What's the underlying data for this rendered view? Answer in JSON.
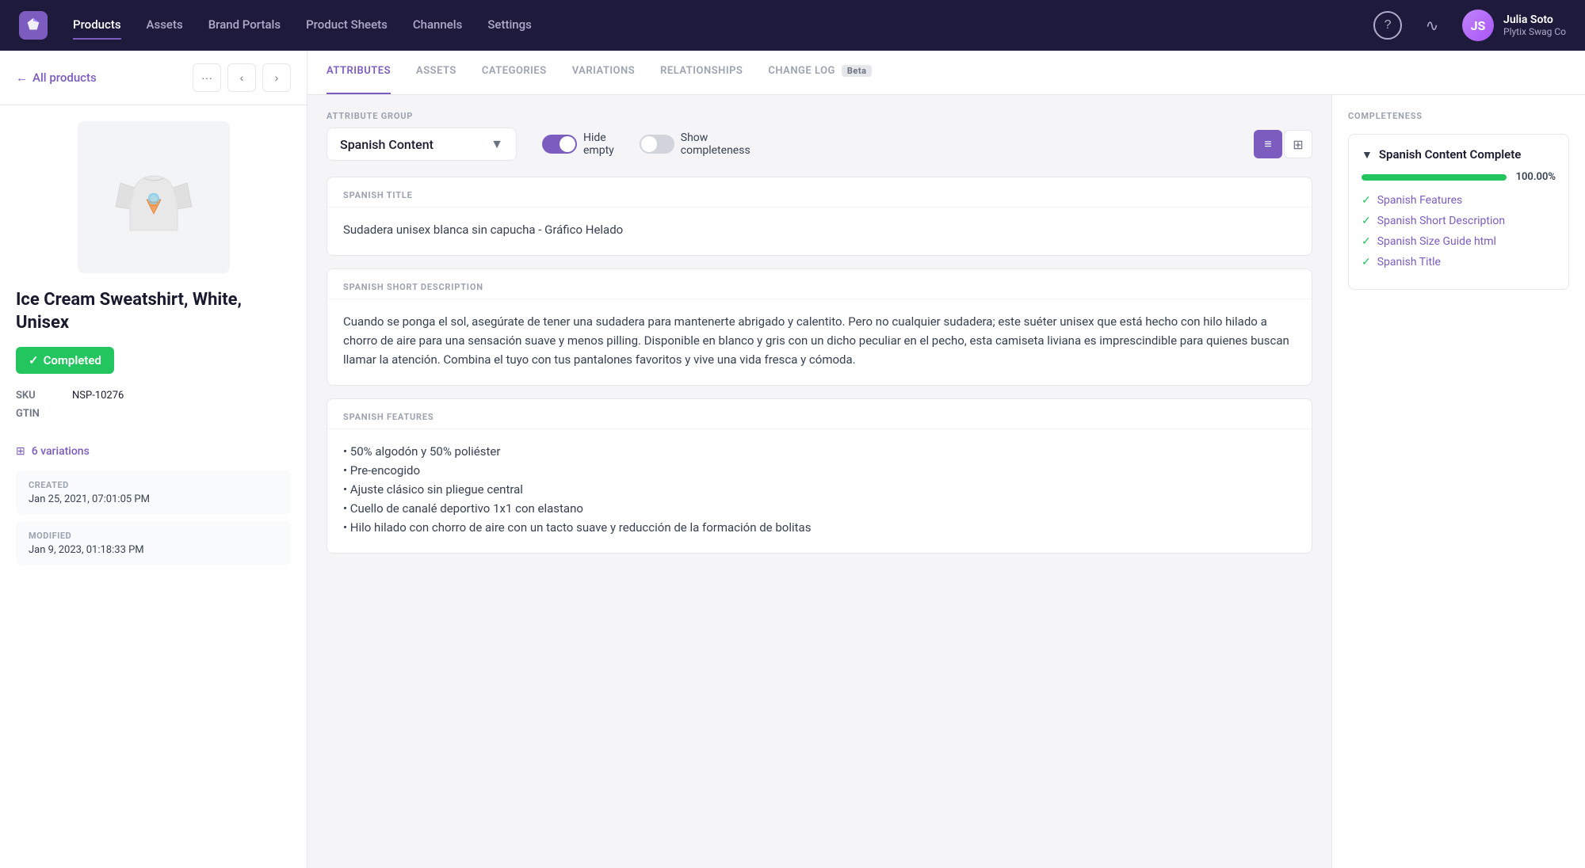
{
  "app": {
    "logo_text": "P",
    "nav_links": [
      "Products",
      "Assets",
      "Brand Portals",
      "Product Sheets",
      "Channels",
      "Settings"
    ],
    "active_nav": "Products",
    "user": {
      "name": "Julia Soto",
      "company": "Plytix Swag Co",
      "avatar_initials": "JS"
    }
  },
  "breadcrumb": {
    "back_label": "All products"
  },
  "product": {
    "name": "Ice Cream Sweatshirt, White, Unisex",
    "status": "Completed",
    "sku_label": "SKU",
    "sku_value": "NSP-10276",
    "gtin_label": "GTIN",
    "gtin_value": "",
    "variations_count": "6 variations",
    "created_label": "CREATED",
    "created_value": "Jan 25, 2021, 07:01:05 PM",
    "modified_label": "MODIFIED",
    "modified_value": "Jan 9, 2023, 01:18:33 PM"
  },
  "tabs": [
    {
      "id": "attributes",
      "label": "ATTRIBUTES",
      "active": true
    },
    {
      "id": "assets",
      "label": "ASSETS"
    },
    {
      "id": "categories",
      "label": "CATEGORIES"
    },
    {
      "id": "variations",
      "label": "VARIATIONS"
    },
    {
      "id": "relationships",
      "label": "RELATIONSHIPS"
    },
    {
      "id": "changelog",
      "label": "CHANGE LOG",
      "badge": "Beta"
    }
  ],
  "attribute_group": {
    "label": "ATTRIBUTE GROUP",
    "selected": "Spanish Content"
  },
  "toggles": {
    "hide_empty": {
      "label_line1": "Hide",
      "label_line2": "empty",
      "state": "on"
    },
    "show_completeness": {
      "label_line1": "Show",
      "label_line2": "completeness",
      "state": "off"
    }
  },
  "attributes": [
    {
      "id": "spanish-title",
      "label": "SPANISH TITLE",
      "value": "Sudadera unisex blanca sin capucha - Gráfico Helado"
    },
    {
      "id": "spanish-short-description",
      "label": "SPANISH SHORT DESCRIPTION",
      "value": "Cuando se ponga el sol, asegúrate de tener una sudadera para mantenerte abrigado y calentito. Pero no cualquier sudadera; este suéter unisex que está hecho con hilo hilado a chorro de aire para una sensación suave y menos pilling. Disponible en blanco y gris con un dicho peculiar en el pecho, esta camiseta liviana es imprescindible para quienes buscan llamar la atención. Combina el tuyo con tus pantalones favoritos y vive una vida fresca y cómoda."
    },
    {
      "id": "spanish-features",
      "label": "SPANISH FEATURES",
      "value": "• 50% algodón y 50% poliéster\n• Pre-encogido\n• Ajuste clásico sin pliegue central\n• Cuello de canalé deportivo 1x1 con elastano\n• Hilo hilado con chorro de aire con un tacto suave y reducción de la formación de bolitas"
    }
  ],
  "completeness": {
    "title": "COMPLETENESS",
    "group_name": "Spanish Content Complete",
    "percentage": "100.00%",
    "percentage_num": 100,
    "items": [
      {
        "label": "Spanish Features"
      },
      {
        "label": "Spanish Short Description"
      },
      {
        "label": "Spanish Size Guide html"
      },
      {
        "label": "Spanish Title"
      }
    ]
  }
}
